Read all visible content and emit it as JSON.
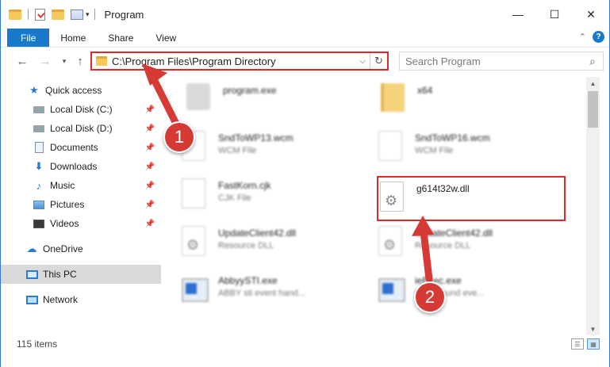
{
  "window": {
    "title": "Program",
    "minimize_glyph": "—",
    "maximize_glyph": "☐",
    "close_glyph": "✕"
  },
  "ribbon": {
    "tabs": [
      "File",
      "Home",
      "Share",
      "View"
    ],
    "help_glyph": "?"
  },
  "address": {
    "path": "C:\\Program Files\\Program Directory",
    "search_placeholder": "Search Program"
  },
  "sidebar": {
    "items": [
      {
        "label": "Quick access",
        "icon": "star-icon",
        "pinned": false
      },
      {
        "label": "Local Disk (C:)",
        "icon": "drive-icon",
        "pinned": true
      },
      {
        "label": "Local Disk (D:)",
        "icon": "drive-icon",
        "pinned": true
      },
      {
        "label": "Documents",
        "icon": "documents-icon",
        "pinned": true
      },
      {
        "label": "Downloads",
        "icon": "downloads-icon",
        "pinned": true
      },
      {
        "label": "Music",
        "icon": "music-icon",
        "pinned": true
      },
      {
        "label": "Pictures",
        "icon": "pictures-icon",
        "pinned": true
      },
      {
        "label": "Videos",
        "icon": "videos-icon",
        "pinned": true
      },
      {
        "label": "OneDrive",
        "icon": "onedrive-icon",
        "pinned": false
      },
      {
        "label": "This PC",
        "icon": "this-pc-icon",
        "pinned": false,
        "selected": true
      },
      {
        "label": "Network",
        "icon": "network-icon",
        "pinned": false
      }
    ]
  },
  "files": [
    {
      "name": "program.exe",
      "type": "",
      "icon": "program-icon"
    },
    {
      "name": "x64",
      "type": "",
      "icon": "folder-icon"
    },
    {
      "name": "SndToWP13.wcm",
      "type": "WCM File",
      "icon": "file-icon"
    },
    {
      "name": "SndToWP16.wcm",
      "type": "WCM File",
      "icon": "file-icon"
    },
    {
      "name": "FastKorn.cjk",
      "type": "CJK File",
      "icon": "file-icon"
    },
    {
      "name": "g614t32w.dll",
      "type": "",
      "icon": "dll-gear-icon"
    },
    {
      "name": "UpdateClient42.dll",
      "type": "Resource DLL",
      "icon": "dll-gear-icon"
    },
    {
      "name": "UpdateClient42.dll",
      "type": "Resource DLL",
      "icon": "dll-gear-icon"
    },
    {
      "name": "AbbyySTI.exe",
      "type": "ABBY sti event hand...",
      "icon": "exe-icon"
    },
    {
      "name": "ieExec.exe",
      "type": "background eve...",
      "icon": "exe-icon"
    }
  ],
  "status": {
    "item_count": "115 items"
  },
  "annotations": {
    "step1": "1",
    "step2": "2",
    "color": "#d63a35"
  }
}
